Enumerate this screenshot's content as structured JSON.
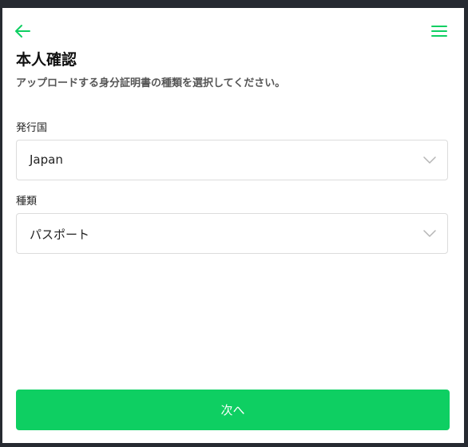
{
  "header": {
    "back_icon": "arrow-left-icon",
    "menu_icon": "hamburger-menu-icon",
    "accent_color": "#0ecf62"
  },
  "page": {
    "title": "本人確認",
    "subtitle": "アップロードする身分証明書の種類を選択してください。"
  },
  "form": {
    "country": {
      "label": "発行国",
      "value": "Japan"
    },
    "doc_type": {
      "label": "種類",
      "value": "パスポート"
    }
  },
  "footer": {
    "next_label": "次へ",
    "button_color": "#0ecf62"
  }
}
